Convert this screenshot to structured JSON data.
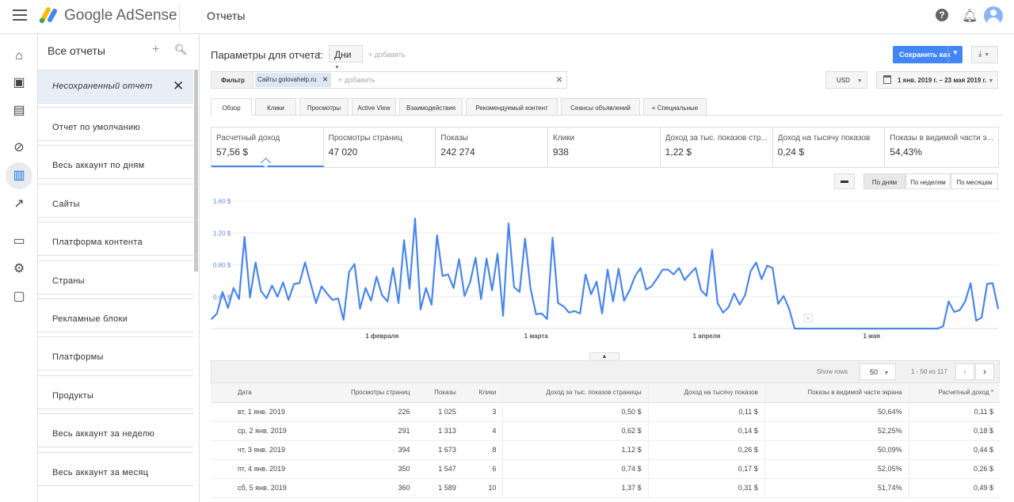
{
  "topbar": {
    "brand": "Google AdSense",
    "title": "Отчеты",
    "help_icon": "help-icon",
    "bell_icon": "bell-icon"
  },
  "rail": [
    "home-icon",
    "ads-icon",
    "sites-icon",
    "block-icon",
    "reports-icon",
    "optimization-icon",
    "payments-icon",
    "settings-icon",
    "feedback-icon"
  ],
  "sidebar": {
    "header": "Все отчеты",
    "add": "+",
    "unsaved": "Несохраненный отчет",
    "close": "✕",
    "items": [
      "Отчет по умолчанию",
      "Весь аккаунт по дням",
      "Сайты",
      "Платформа контента",
      "Страны",
      "Рекламные блоки",
      "Платформы",
      "Продукты",
      "Весь аккаунт за неделю",
      "Весь аккаунт за месяц"
    ]
  },
  "params": {
    "label": "Параметры для отчета:",
    "dimension": "Дни",
    "add": "+ добавить",
    "save": "Сохранить как"
  },
  "filter": {
    "label": "Фильтр",
    "chip": "Сайты golovahelp.ru",
    "add": "+ добавить"
  },
  "currency": "USD",
  "date_range": "1 янв. 2019 г. – 23 мая 2019 г.",
  "tabs": [
    "Обзор",
    "Клики",
    "Просмотры",
    "Active View",
    "Взаимодействия",
    "Рекомендуемый контент",
    "Сеансы объявлений",
    "+ Специальные"
  ],
  "kpis": [
    {
      "label": "Расчетный доход",
      "value": "57,56 $"
    },
    {
      "label": "Просмотры страниц",
      "value": "47 020"
    },
    {
      "label": "Показы",
      "value": "242 274"
    },
    {
      "label": "Клики",
      "value": "938"
    },
    {
      "label": "Доход за тыс. показов стр...",
      "value": "1,22 $"
    },
    {
      "label": "Доход на тысячу показов",
      "value": "0,24 $"
    },
    {
      "label": "Показы в видимой части э...",
      "value": "54,43%"
    }
  ],
  "granularity": [
    "По дням",
    "По неделям",
    "По месяцам"
  ],
  "chart_data": {
    "type": "line",
    "title": "",
    "xlabel": "",
    "ylabel": "Расчетный доход",
    "ylim": [
      0,
      1.6
    ],
    "yticks": [
      "1,60 $",
      "1,20 $",
      "0,80 $",
      "0,40 $"
    ],
    "ytick_values": [
      1.6,
      1.2,
      0.8,
      0.4
    ],
    "x_start": "1 янв. 2019",
    "x_end": "23 мая 2019",
    "xticks": [
      {
        "label": "1 февраля",
        "day": 31
      },
      {
        "label": "1 марта",
        "day": 59
      },
      {
        "label": "1 апреля",
        "day": 90
      },
      {
        "label": "1 мая",
        "day": 120
      }
    ],
    "color": "#4a86e8",
    "series": [
      {
        "name": "Расчетный доход",
        "values": [
          0.12,
          0.19,
          0.46,
          0.26,
          0.51,
          0.37,
          1.15,
          0.39,
          0.83,
          0.47,
          0.38,
          0.54,
          0.4,
          0.58,
          0.36,
          0.56,
          0.57,
          0.83,
          0.57,
          0.32,
          0.53,
          0.44,
          0.36,
          0.38,
          0.11,
          0.71,
          0.81,
          0.25,
          0.51,
          0.35,
          0.65,
          0.42,
          0.34,
          0.76,
          0.32,
          1.11,
          0.5,
          1.38,
          0.24,
          0.51,
          0.3,
          1.17,
          0.66,
          0.68,
          0.51,
          0.87,
          0.41,
          0.58,
          0.89,
          0.37,
          0.88,
          0.48,
          0.94,
          0.16,
          1.32,
          0.52,
          0.46,
          1.13,
          0.5,
          0.18,
          0.19,
          0.12,
          1.14,
          0.32,
          0.28,
          0.2,
          0.22,
          0.19,
          0.68,
          0.43,
          0.59,
          0.19,
          0.74,
          0.34,
          0.75,
          0.35,
          0.48,
          0.66,
          0.76,
          0.49,
          0.53,
          0.63,
          0.74,
          0.74,
          0.68,
          0.76,
          0.61,
          0.69,
          0.76,
          0.48,
          0.41,
          0.99,
          0.32,
          0.2,
          0.27,
          0.44,
          0.3,
          0.42,
          0.72,
          0.83,
          0.62,
          0.79,
          0.76,
          0.31,
          0.41,
          0.25,
          0,
          0,
          0,
          0,
          0,
          0,
          0,
          0,
          0,
          0,
          0,
          0,
          0,
          0,
          0,
          0,
          0,
          0,
          0,
          0,
          0,
          0,
          0,
          0,
          0,
          0,
          0,
          0.03,
          0.34,
          0.21,
          0.23,
          0.34,
          0.57,
          0.1,
          0.14,
          0.56,
          0.57,
          0.25
        ]
      }
    ]
  },
  "table": {
    "show_rows_label": "Show rows",
    "rows_per_page": "50",
    "pagination": "1 - 50 из 117",
    "columns": [
      "Дата",
      "Просмотры страниц",
      "Показы",
      "Клики",
      "Доход за тыс. показов страницы",
      "Доход на тысячу показов",
      "Показы в видимой части экрана",
      "Расчетный доход *"
    ],
    "rows": [
      [
        "вт, 1 янв. 2019",
        "226",
        "1 025",
        "3",
        "0,50 $",
        "0,11 $",
        "50,64%",
        "0,11 $"
      ],
      [
        "ср, 2 янв. 2019",
        "291",
        "1 313",
        "4",
        "0,62 $",
        "0,14 $",
        "52,25%",
        "0,18 $"
      ],
      [
        "чт, 3 янв. 2019",
        "394",
        "1 673",
        "8",
        "1,12 $",
        "0,26 $",
        "50,09%",
        "0,44 $"
      ],
      [
        "пт, 4 янв. 2019",
        "350",
        "1 547",
        "6",
        "0,74 $",
        "0,17 $",
        "52,05%",
        "0,26 $"
      ],
      [
        "сб, 5 янв. 2019",
        "360",
        "1 589",
        "10",
        "1,37 $",
        "0,31 $",
        "51,74%",
        "0,49 $"
      ]
    ]
  }
}
